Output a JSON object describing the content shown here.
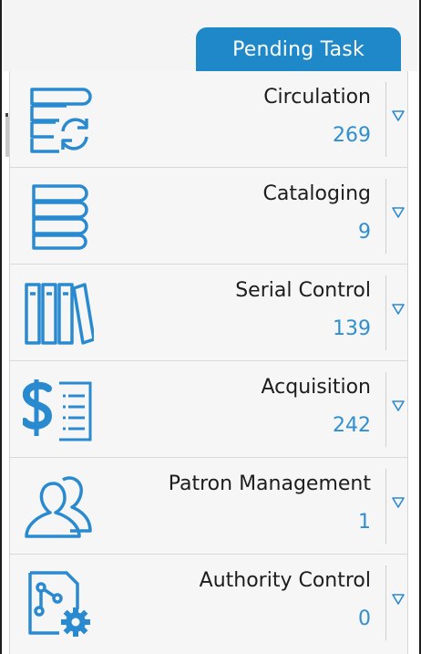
{
  "header": {
    "tab_label": "Pending Task"
  },
  "colors": {
    "accent": "#1e88c8",
    "count": "#2f8fd0",
    "icon": "#2a8ad0",
    "tab_text": "#ffffff"
  },
  "tasks": [
    {
      "label": "Circulation",
      "count": "269",
      "icon": "circulation-icon"
    },
    {
      "label": "Cataloging",
      "count": "9",
      "icon": "cataloging-icon"
    },
    {
      "label": "Serial Control",
      "count": "139",
      "icon": "serial-control-icon"
    },
    {
      "label": "Acquisition",
      "count": "242",
      "icon": "acquisition-icon"
    },
    {
      "label": "Patron Management",
      "count": "1",
      "icon": "patron-management-icon"
    },
    {
      "label": "Authority Control",
      "count": "0",
      "icon": "authority-control-icon"
    }
  ]
}
